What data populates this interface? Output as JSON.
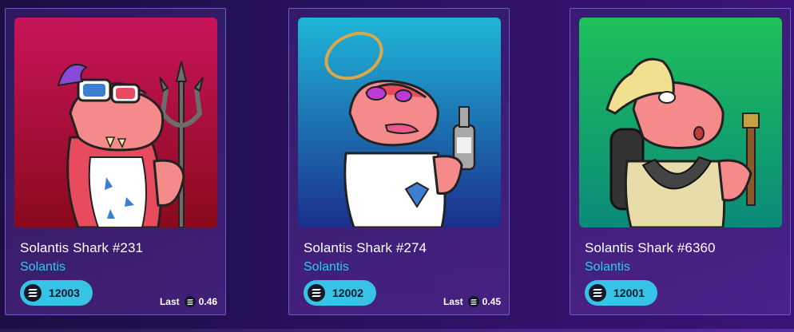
{
  "cards": [
    {
      "name": "Solantis Shark #231",
      "collection": "Solantis",
      "price": "12003",
      "last_label": "Last",
      "last_value": "0.46",
      "art_bg": [
        "#c8145a",
        "#8a0a1c"
      ],
      "art_icon": "shark-devil-trident-icon"
    },
    {
      "name": "Solantis Shark #274",
      "collection": "Solantis",
      "price": "12002",
      "last_label": "Last",
      "last_value": "0.45",
      "art_bg": [
        "#1fb6d8",
        "#1a2f8c"
      ],
      "art_icon": "shark-angel-bottle-icon"
    },
    {
      "name": "Solantis Shark #6360",
      "collection": "Solantis",
      "price": "12001",
      "art_bg": [
        "#1fc05a",
        "#0a8a7a"
      ],
      "art_icon": "shark-explorer-torch-icon"
    }
  ],
  "colors": {
    "accent": "#36c3e6",
    "collection_link": "#37c6f0",
    "card_border": "#6a5cc0"
  }
}
